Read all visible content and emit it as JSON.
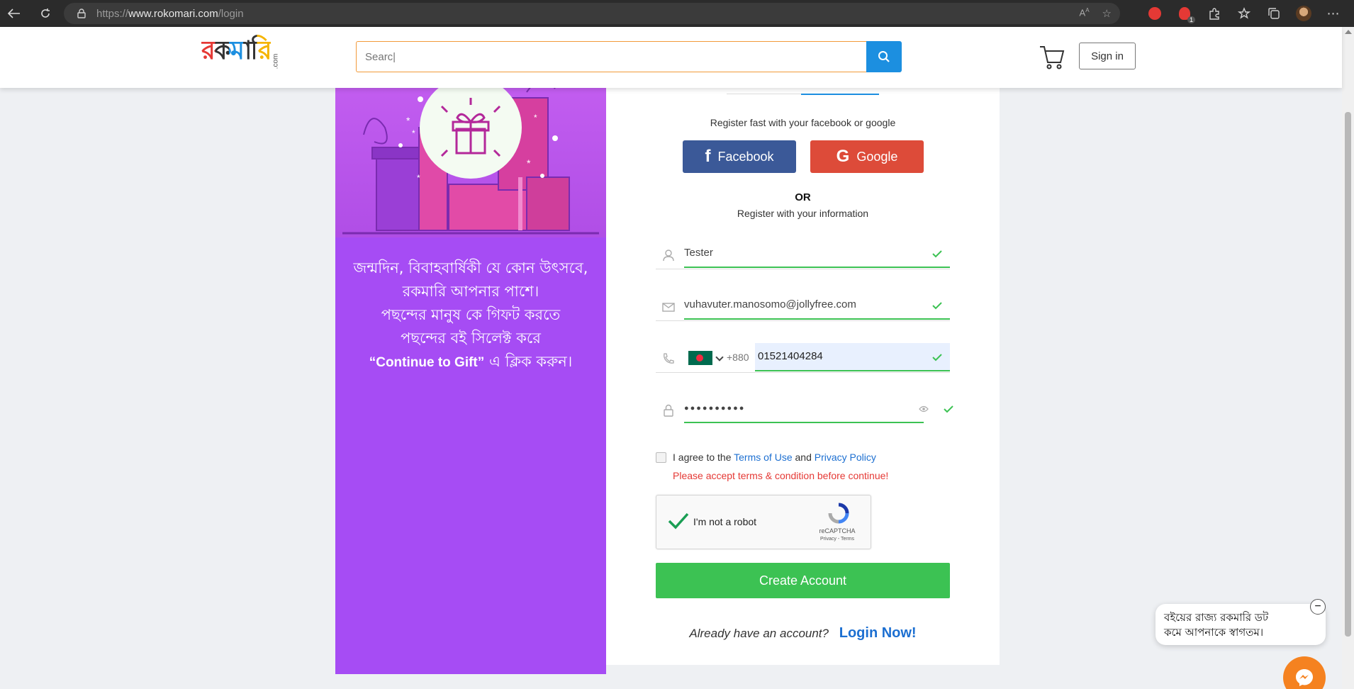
{
  "browser": {
    "url_prefix": "https://",
    "url_domain": "www.rokomari.com",
    "url_path": "/login",
    "notification_count": "1"
  },
  "header": {
    "logo_text": "রকমারি",
    "logo_com": ".com",
    "search_placeholder": "Searc|",
    "signin_label": "Sign in"
  },
  "promo": {
    "line1": "জন্মদিন, বিবাহবার্ষিকী যে কোন উৎসবে,",
    "line2": "রকমারি আপনার পাশে।",
    "line3": "পছন্দের মানুষ কে গিফট করতে",
    "line4": "পছন্দের বই সিলেক্ট করে",
    "line5_en": "“Continue to Gift”",
    "line5_bn": " এ ক্লিক করুন।"
  },
  "register": {
    "fast_text": "Register fast with your facebook or google",
    "facebook_label": "Facebook",
    "google_label": "Google",
    "or_label": "OR",
    "info_text": "Register with your information",
    "name_value": "Tester",
    "email_value": "vuhavuter.manosomo@jollyfree.com",
    "phone_code": "+880",
    "phone_value": "01521404284",
    "password_dots": "●●●●●●●●●●",
    "agree_prefix": "I agree to the ",
    "terms_label": "Terms of Use",
    "agree_and": " and ",
    "privacy_label": "Privacy Policy",
    "error_text": "Please accept terms & condition before continue!",
    "captcha_label": "I'm not a robot",
    "captcha_brand": "reCAPTCHA",
    "captcha_terms": "Privacy - Terms",
    "create_label": "Create Account",
    "already_text": "Already have an account?",
    "login_now_label": "Login Now!"
  },
  "chat": {
    "message_line1": "বইয়ের রাজ্য রকমারি ডট",
    "message_line2": "কমে আপনাকে স্বাগতম।",
    "close_symbol": "−"
  },
  "colors": {
    "accent_blue": "#1c8fe0",
    "success_green": "#3cc253",
    "promo_purple": "#a64cf4",
    "facebook_blue": "#3b5998",
    "google_red": "#dd4b39",
    "error_red": "#e53935"
  }
}
